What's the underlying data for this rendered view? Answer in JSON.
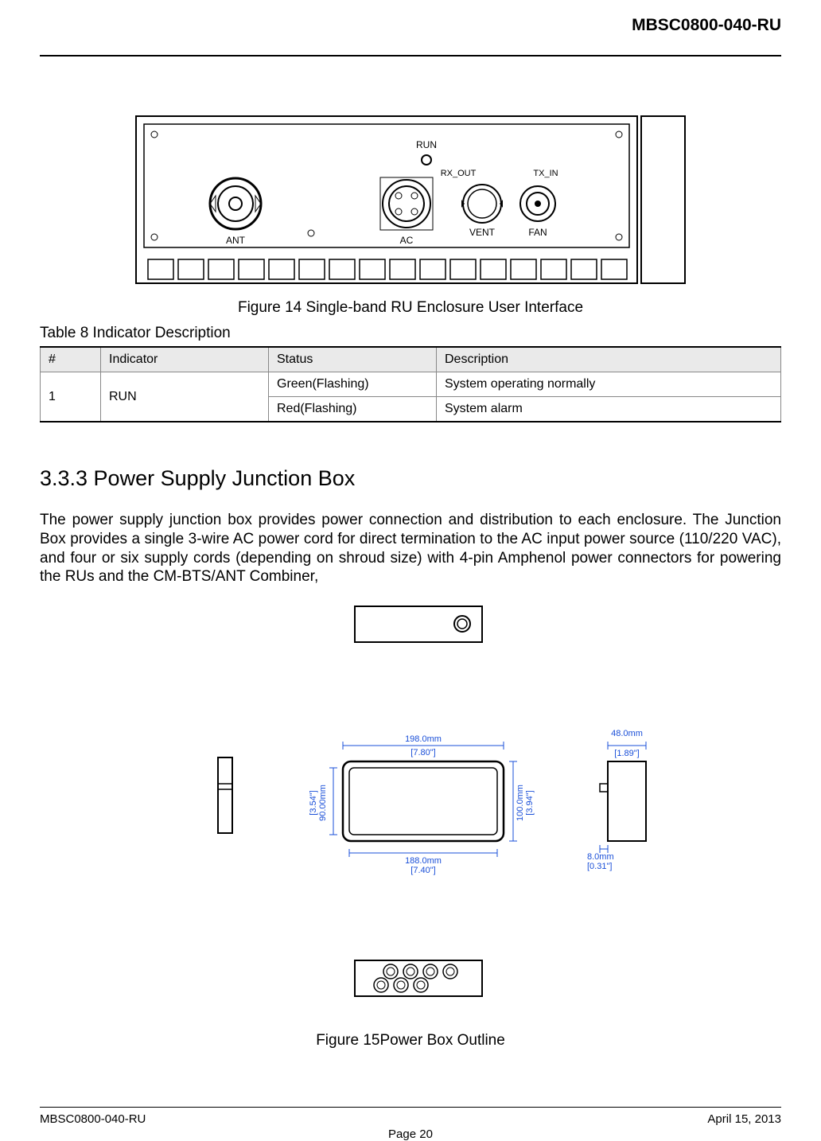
{
  "header": {
    "doc_id": "MBSC0800-040-RU"
  },
  "figure14": {
    "caption": "Figure 14 Single-band RU Enclosure User Interface",
    "labels": {
      "run": "RUN",
      "rx_out": "RX_OUT",
      "tx_in": "TX_IN",
      "ant": "ANT",
      "ac": "AC",
      "vent": "VENT",
      "fan": "FAN"
    }
  },
  "table8": {
    "caption": "Table 8 Indicator Description",
    "headers": {
      "num": "#",
      "indicator": "Indicator",
      "status": "Status",
      "description": "Description"
    },
    "rows": [
      {
        "num": "1",
        "indicator": "RUN",
        "status": "Green(Flashing)",
        "description": "System operating normally"
      },
      {
        "num": "",
        "indicator": "",
        "status": "Red(Flashing)",
        "description": "System alarm"
      }
    ]
  },
  "section333": {
    "heading": "3.3.3  Power Supply Junction Box",
    "paragraph": "The power supply junction box provides power connection and distribution to each enclosure. The Junction Box provides a single 3-wire AC power cord for direct termination to the AC input power source (110/220 VAC), and four or six supply cords (depending on shroud size) with 4-pin Amphenol power connectors for powering the RUs and the CM-BTS/ANT Combiner,"
  },
  "figure15": {
    "caption": "Figure 15Power Box Outline",
    "dims": {
      "top_width_mm": "198.0mm",
      "top_width_in": "[7.80\"]",
      "bottom_width_mm": "188.0mm",
      "bottom_width_in": "[7.40\"]",
      "left_height_mm": "90.00mm",
      "left_height_in": "[3.54\"]",
      "right_height_mm": "100.0mm",
      "right_height_in": "[3.94\"]",
      "side_width_mm": "48.0mm",
      "side_width_in": "[1.89\"]",
      "side_gap_mm": "8.0mm",
      "side_gap_in": "[0.31\"]"
    }
  },
  "footer": {
    "left": "MBSC0800-040-RU",
    "right": "April 15, 2013",
    "page": "Page 20"
  }
}
